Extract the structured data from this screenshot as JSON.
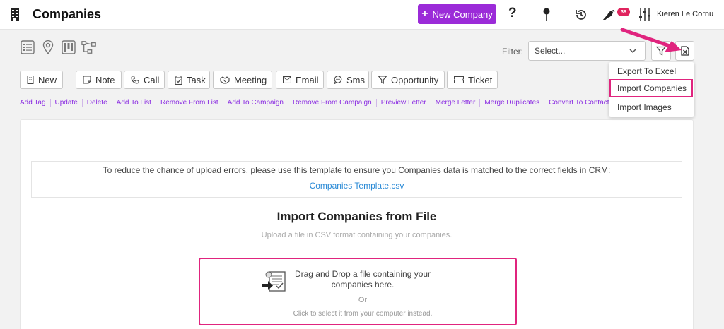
{
  "header": {
    "title": "Companies",
    "new_company_label": "New Company",
    "notification_count": "38",
    "user_name": "Kieren Le Cornu",
    "brand_color": "#9b2bd8"
  },
  "views": [
    "list-view-icon",
    "map-view-icon",
    "board-view-icon",
    "hierarchy-view-icon"
  ],
  "filter": {
    "label": "Filter:",
    "placeholder": "Select..."
  },
  "actions": {
    "new": "New",
    "note": "Note",
    "call": "Call",
    "task": "Task",
    "meeting": "Meeting",
    "email": "Email",
    "sms": "Sms",
    "opportunity": "Opportunity",
    "ticket": "Ticket"
  },
  "links": [
    "Add Tag",
    "Update",
    "Delete",
    "Add To List",
    "Remove From List",
    "Add To Campaign",
    "Remove From Campaign",
    "Preview Letter",
    "Merge Letter",
    "Merge Duplicates",
    "Convert To Contacts"
  ],
  "menu": {
    "export_excel": "Export To Excel",
    "import_companies": "Import Companies",
    "import_images": "Import Images"
  },
  "import": {
    "template_text": "To reduce the chance of upload errors, please use this template to ensure you Companies data is matched to the correct fields in CRM:",
    "template_link": "Companies Template.csv",
    "title": "Import Companies from File",
    "subtitle": "Upload a file in CSV format containing your companies.",
    "drop_line1": "Drag and Drop a file containing your",
    "drop_line2": "companies here.",
    "or": "Or",
    "click_text": "Click to select it from your computer instead."
  },
  "colors": {
    "highlight": "#e0247e",
    "link": "#8a2be2",
    "template_link": "#2a8ad6"
  }
}
